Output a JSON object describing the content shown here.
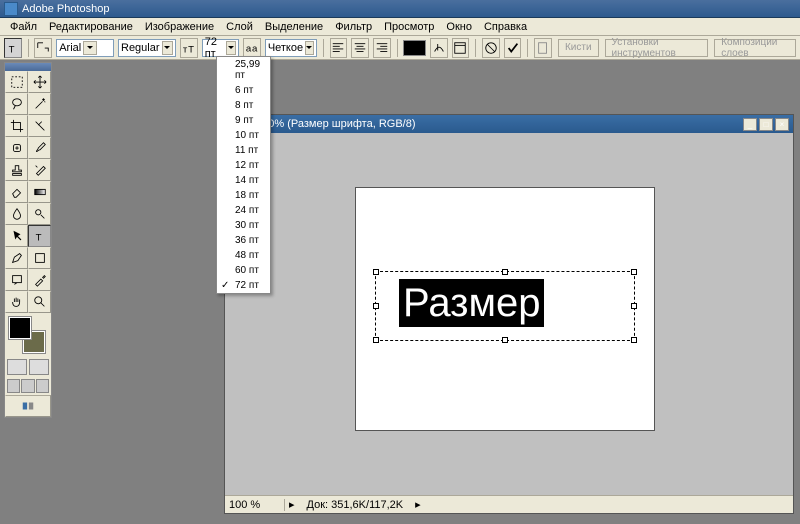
{
  "titlebar": {
    "app_name": "Adobe Photoshop"
  },
  "menu": {
    "file": "Файл",
    "edit": "Редактирование",
    "image": "Изображение",
    "layer": "Слой",
    "select": "Выделение",
    "filter": "Фильтр",
    "view": "Просмотр",
    "window": "Окно",
    "help": "Справка"
  },
  "options": {
    "font_family": "Arial",
    "font_style": "Regular",
    "font_size": "72 пт",
    "aa_label": "Четкое"
  },
  "size_menu": {
    "items": [
      "25,99 пт",
      "6 пт",
      "8 пт",
      "9 пт",
      "10 пт",
      "11 пт",
      "12 пт",
      "14 пт",
      "18 пт",
      "24 пт",
      "30 пт",
      "36 пт",
      "48 пт",
      "60 пт",
      "72 пт"
    ],
    "checked": "72 пт"
  },
  "palette_tabs": {
    "brushes": "Кисти",
    "tool_presets": "Установки инструментов",
    "layer_comps": "Композиции слоев"
  },
  "document": {
    "title": "-1 @ 100% (Размер шрифта, RGB/8)",
    "zoom": "100 %",
    "doc_info": "Док: 351,6K/117,2K",
    "canvas_text": "Размер"
  }
}
